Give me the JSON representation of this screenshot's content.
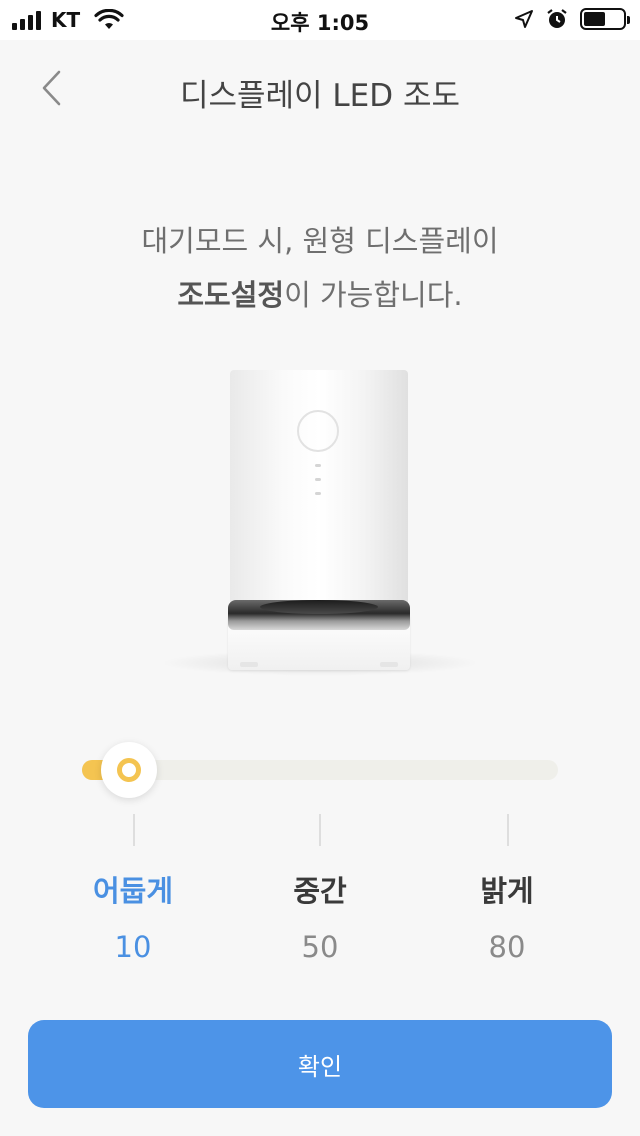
{
  "status_bar": {
    "carrier": "KT",
    "time": "오후 1:05",
    "icons": [
      "signal-icon",
      "wifi-icon",
      "location-arrow-icon",
      "alarm-icon",
      "battery-icon"
    ]
  },
  "nav": {
    "back_icon": "chevron-left-icon",
    "title": "디스플레이 LED 조도"
  },
  "description": {
    "line1": "대기모드 시, 원형 디스플레이",
    "line2_bold": "조도설정",
    "line2_rest": "이 가능합니다."
  },
  "slider": {
    "min": 10,
    "max": 80,
    "value": 10,
    "fill_color": "#f4c451",
    "track_color": "#efefea"
  },
  "levels": [
    {
      "name": "어둡게",
      "value": "10",
      "active": true
    },
    {
      "name": "중간",
      "value": "50",
      "active": false
    },
    {
      "name": "밝게",
      "value": "80",
      "active": false
    }
  ],
  "confirm_label": "확인",
  "colors": {
    "accent": "#4a90e2",
    "button": "#4d94e8",
    "background": "#f7f7f7"
  }
}
